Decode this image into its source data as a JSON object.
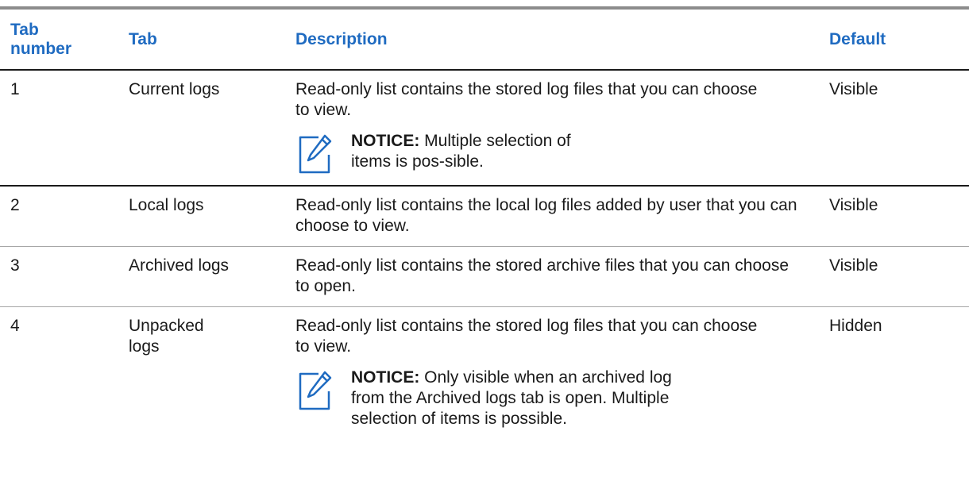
{
  "headers": {
    "number": "Tab\nnumber",
    "tab": "Tab",
    "description": "Description",
    "default": "Default"
  },
  "rows": [
    {
      "number": "1",
      "tab": "Current logs",
      "description": "Read-only list contains the stored log files that you can choose to view.",
      "notice_label": "NOTICE:",
      "notice_text": "Multiple selection of items is pos-sible.",
      "default": "Visible"
    },
    {
      "number": "2",
      "tab": "Local logs",
      "description": "Read-only list contains the local log files added by user that you can choose to view.",
      "default": "Visible"
    },
    {
      "number": "3",
      "tab": "Archived logs",
      "description": "Read-only list contains the stored archive files that you can choose to open.",
      "default": "Visible"
    },
    {
      "number": "4",
      "tab": "Unpacked logs",
      "description": "Read-only list contains the stored log files that you can choose to view.",
      "notice_label": "NOTICE:",
      "notice_text": "Only visible when an archived log from the Archived logs tab is open. Multiple selection of items is possible.",
      "default": "Hidden"
    }
  ],
  "icons": {
    "notice": "pencil-note-icon"
  },
  "colors": {
    "header_text": "#1f6bc1",
    "icon": "#1f6bc1"
  }
}
